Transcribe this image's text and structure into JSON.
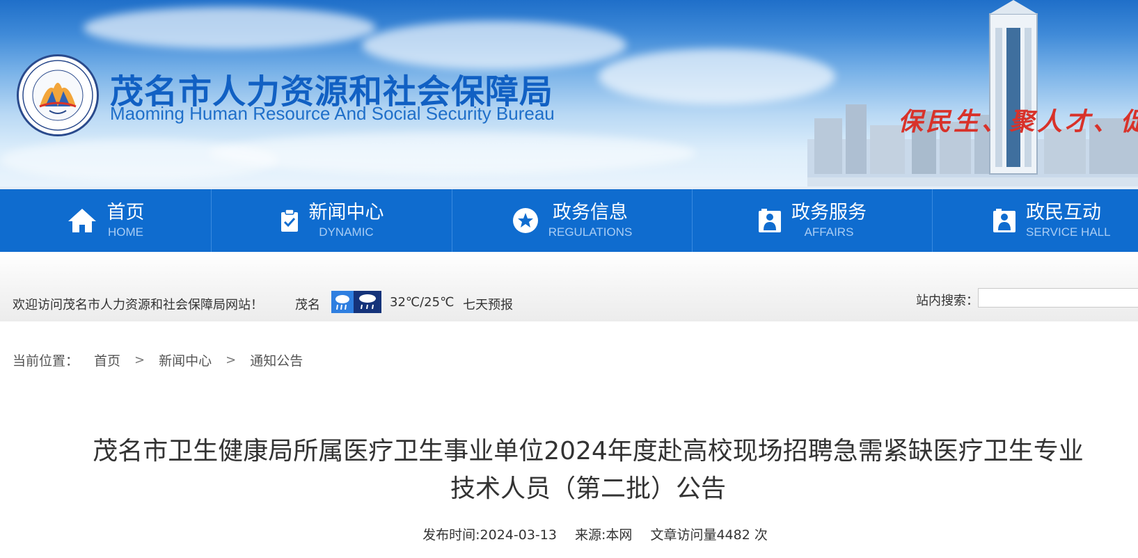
{
  "header": {
    "title_cn": "茂名市人力资源和社会保障局",
    "title_en": "Maoming Human Resource And Social Security Bureau",
    "slogan": "保民生、聚人才、促发"
  },
  "nav": {
    "items": [
      {
        "cn": "首页",
        "en": "HOME",
        "icon": "home-icon"
      },
      {
        "cn": "新闻中心",
        "en": "DYNAMIC",
        "icon": "clipboard-check-icon"
      },
      {
        "cn": "政务信息",
        "en": "REGULATIONS",
        "icon": "star-circle-icon"
      },
      {
        "cn": "政务服务",
        "en": "AFFAIRS",
        "icon": "service-icon"
      },
      {
        "cn": "政民互动",
        "en": "SERVICE HALL",
        "icon": "service-icon"
      }
    ]
  },
  "infobar": {
    "welcome": "欢迎访问茂名市人力资源和社会保障局网站！",
    "city": "茂名",
    "weather_icons": [
      "rain-icon",
      "thunderstorm-icon"
    ],
    "temperature": "32℃/25℃",
    "forecast": "七天预报",
    "search_label": "站内搜索：",
    "search_value": ""
  },
  "breadcrumb": {
    "label": "当前位置：",
    "items": [
      "首页",
      "新闻中心",
      "通知公告"
    ]
  },
  "article": {
    "title_line1": "茂名市卫生健康局所属医疗卫生事业单位2024年度赴高校现场招聘急需紧缺医疗卫生专业",
    "title_line2": "技术人员（第二批）公告",
    "publish": "发布时间:2024-03-13",
    "source": "来源:本网",
    "views": "文章访问量4482 次"
  },
  "colors": {
    "nav_bg": "#0f6ccf",
    "title_blue": "#1160c3",
    "slogan_red": "#d8322a"
  }
}
